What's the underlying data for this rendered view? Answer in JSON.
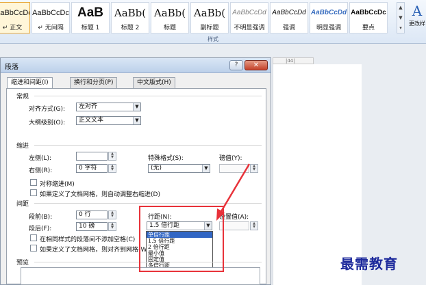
{
  "ribbon": {
    "styles": [
      {
        "preview": "AaBbCcDc",
        "name": "↵ 正文"
      },
      {
        "preview": "AaBbCcDc",
        "name": "↵ 无间隔"
      },
      {
        "preview": "AaB",
        "name": "标题 1"
      },
      {
        "preview": "AaBb(",
        "name": "标题 2"
      },
      {
        "preview": "AaBb(",
        "name": "标题"
      },
      {
        "preview": "AaBb(",
        "name": "副标题"
      },
      {
        "preview": "AaBbCcDd",
        "name": "不明显强调"
      },
      {
        "preview": "AaBbCcDd",
        "name": "强调"
      },
      {
        "preview": "AaBbCcDd",
        "name": "明显强调"
      },
      {
        "preview": "AaBbCcDc",
        "name": "要点"
      }
    ],
    "change_styles_label": "更改样",
    "group_label": "样式"
  },
  "ruler_text": "|44|",
  "dialog": {
    "title": "段落",
    "tabs": [
      "缩进和间距(I)",
      "换行和分页(P)",
      "中文版式(H)"
    ],
    "general": {
      "heading": "常规",
      "alignment_label": "对齐方式(G):",
      "alignment_value": "左对齐",
      "outline_label": "大纲级别(O):",
      "outline_value": "正文文本"
    },
    "indent": {
      "heading": "缩进",
      "left_label": "左侧(L):",
      "left_value": "",
      "right_label": "右侧(R):",
      "right_value": "0 字符",
      "special_label": "特殊格式(S):",
      "special_value": "(无)",
      "by_label": "磅值(Y):",
      "by_value": "",
      "mirror_label": "对称缩进(M)",
      "auto_adjust_label": "如果定义了文档网格，则自动调整右缩进(D)"
    },
    "spacing": {
      "heading": "间距",
      "before_label": "段前(B):",
      "before_value": "0 行",
      "after_label": "段后(F):",
      "after_value": "10 磅",
      "line_spacing_label": "行距(N):",
      "line_spacing_value": "1.5 倍行距",
      "at_label": "设置值(A):",
      "at_value": "",
      "dont_add_label": "在相同样式的段落间不添加空格(C)",
      "snap_grid_label": "如果定义了文档网格，则对齐到网格(W)"
    },
    "line_spacing_options": [
      "单倍行距",
      "1.5 倍行距",
      "2 倍行距",
      "最小值",
      "固定值",
      "多倍行距"
    ],
    "line_spacing_selected_index": 0,
    "preview_heading": "预览"
  },
  "watermark": "最需教育",
  "colors": {
    "highlight": "#e8323a",
    "selection": "#3166c4",
    "watermark": "#1d2a9c"
  }
}
